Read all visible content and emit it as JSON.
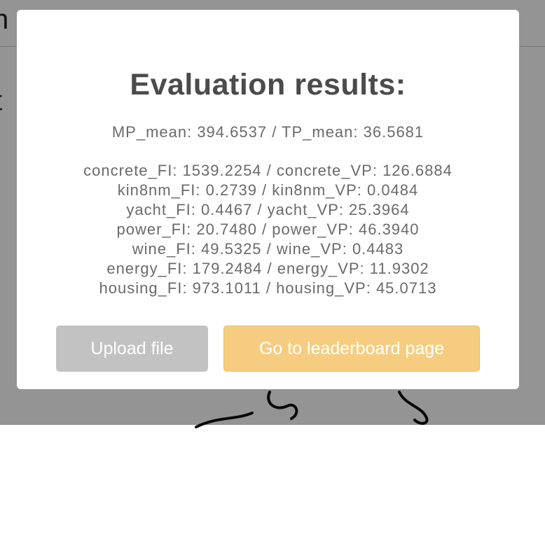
{
  "background": {
    "header_text": "n",
    "body_text": "t"
  },
  "modal": {
    "title": "Evaluation results:",
    "mean_line": "MP_mean: 394.6537 / TP_mean: 36.5681",
    "results": [
      "concrete_FI: 1539.2254 / concrete_VP: 126.6884",
      "kin8nm_FI: 0.2739 / kin8nm_VP: 0.0484",
      "yacht_FI: 0.4467 / yacht_VP: 25.3964",
      "power_FI: 20.7480 / power_VP: 46.3940",
      "wine_FI: 49.5325 / wine_VP: 0.4483",
      "energy_FI: 179.2484 / energy_VP: 11.9302",
      "housing_FI: 973.1011 / housing_VP: 45.0713"
    ],
    "buttons": {
      "upload_label": "Upload file",
      "leaderboard_label": "Go to leaderboard page"
    }
  },
  "colors": {
    "upload_button": "#c2c2c2",
    "leaderboard_button": "#f6cd80",
    "overlay": "rgba(0,0,0,0.42)"
  }
}
